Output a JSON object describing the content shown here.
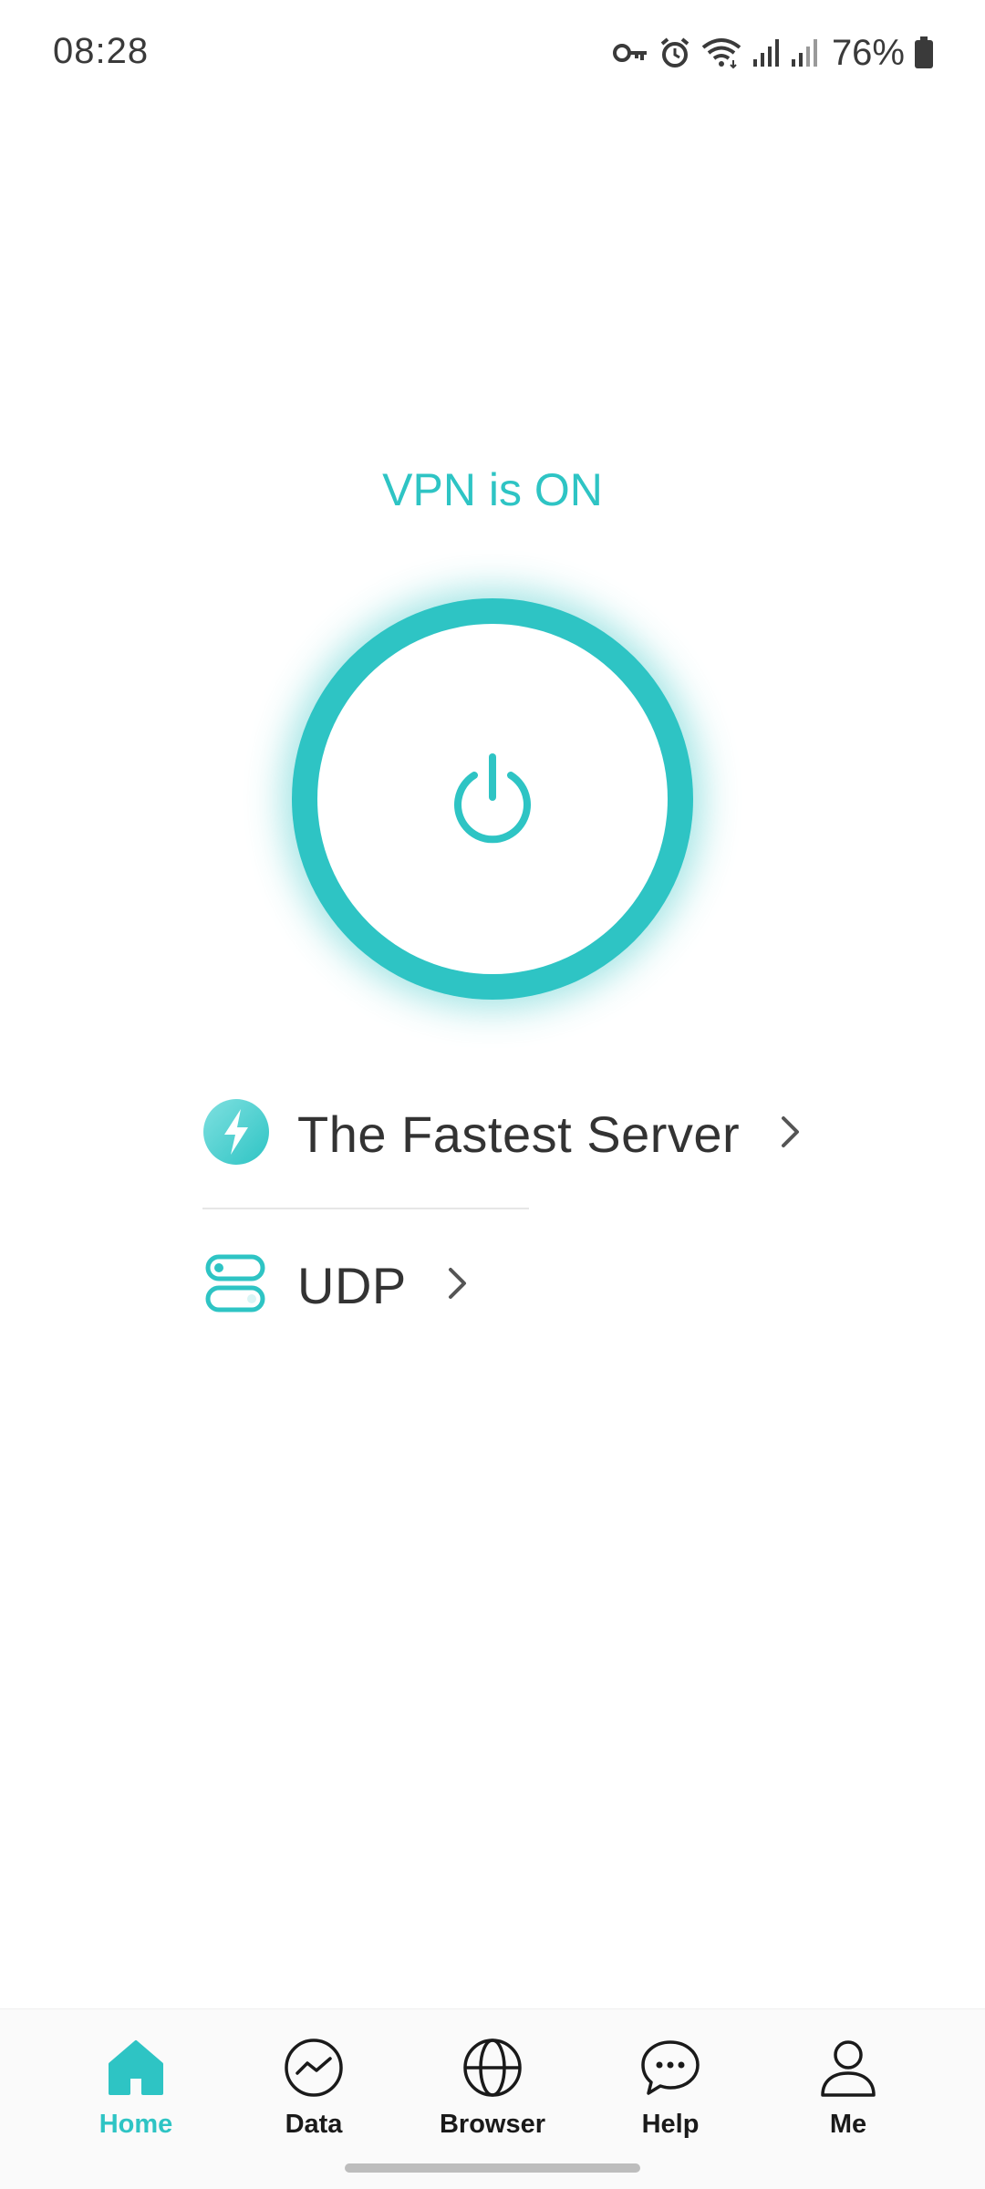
{
  "status_bar": {
    "time": "08:28",
    "battery": "76%",
    "icons": [
      "vpn-key-icon",
      "alarm-icon",
      "wifi-icon",
      "signal-icon",
      "signal-icon",
      "battery-icon"
    ]
  },
  "vpn": {
    "status": "VPN is ON",
    "connected": true,
    "power_icon": "power-icon"
  },
  "options": {
    "server": {
      "label": "The Fastest Server",
      "icon": "lightning-icon"
    },
    "protocol": {
      "label": "UDP",
      "icon": "toggle-icon"
    }
  },
  "nav": {
    "items": [
      {
        "label": "Home",
        "icon": "home-icon",
        "active": true
      },
      {
        "label": "Data",
        "icon": "chart-icon",
        "active": false
      },
      {
        "label": "Browser",
        "icon": "globe-icon",
        "active": false
      },
      {
        "label": "Help",
        "icon": "chat-icon",
        "active": false
      },
      {
        "label": "Me",
        "icon": "user-icon",
        "active": false
      }
    ]
  },
  "colors": {
    "accent": "#2ec4c4",
    "text": "#333333",
    "nav_text": "#1a1a1a"
  }
}
